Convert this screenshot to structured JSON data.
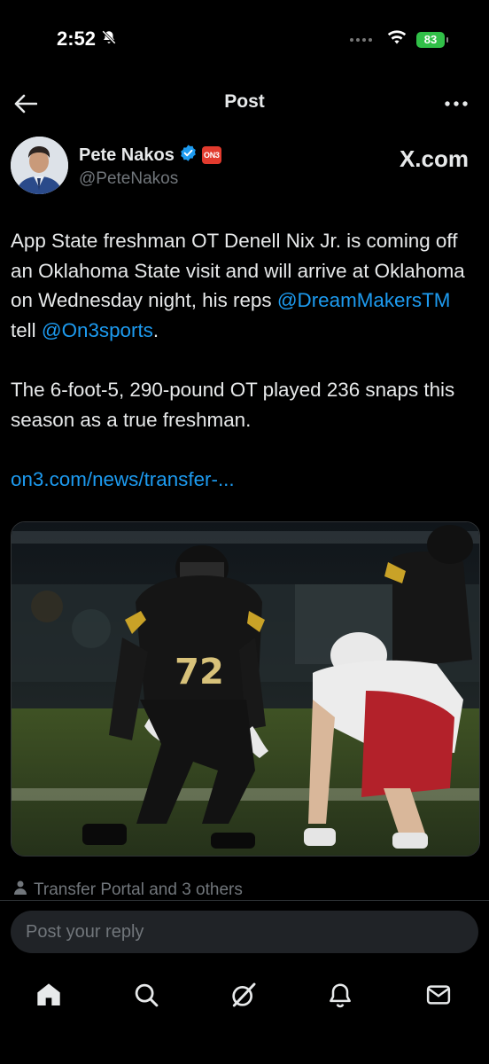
{
  "status_bar": {
    "time": "2:52",
    "battery": "83"
  },
  "header": {
    "title": "Post"
  },
  "author": {
    "name": "Pete Nakos",
    "handle": "@PeteNakos",
    "badge": "ON3",
    "source_label": "X.com"
  },
  "tweet": {
    "line1": "App State freshman OT Denell Nix Jr. is coming off an Oklahoma State visit and will arrive at Oklahoma on Wednesday night, his reps ",
    "mention1": "@DreamMakersTM",
    "mid": " tell ",
    "mention2": "@On3sports",
    "end": ".",
    "paragraph2": "The 6-foot-5, 290-pound OT played 236 snaps this season as a true freshman.",
    "link": "on3.com/news/transfer-..."
  },
  "media": {
    "jersey_number": "72"
  },
  "tags": {
    "label": "Transfer Portal and 3 others"
  },
  "reply": {
    "placeholder": "Post your reply"
  },
  "tab_bar": {
    "items": [
      "home-icon",
      "search-icon",
      "grok-icon",
      "notifications-icon",
      "messages-icon"
    ]
  },
  "colors": {
    "background": "#000000",
    "text": "#e7e9ea",
    "secondary_text": "#71767b",
    "link": "#1d9bf0",
    "verified": "#1d9bf0",
    "badge": "#e23b2e",
    "battery": "#31c048"
  }
}
